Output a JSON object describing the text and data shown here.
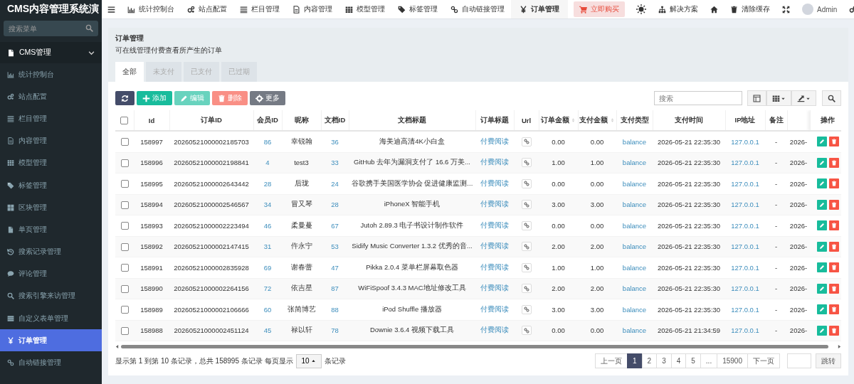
{
  "sidebar": {
    "title": "CMS内容管理系统演",
    "search": {
      "placeholder": "搜索菜单"
    },
    "group": {
      "label": "CMS管理",
      "expanded": true
    },
    "items": [
      {
        "label": "统计控制台",
        "selected": false
      },
      {
        "label": "站点配置",
        "selected": false
      },
      {
        "label": "栏目管理",
        "selected": false
      },
      {
        "label": "内容管理",
        "selected": false
      },
      {
        "label": "模型管理",
        "selected": false
      },
      {
        "label": "标签管理",
        "selected": false
      },
      {
        "label": "区块管理",
        "selected": false
      },
      {
        "label": "单页管理",
        "selected": false
      },
      {
        "label": "搜索记录管理",
        "selected": false
      },
      {
        "label": "评论管理",
        "selected": false
      },
      {
        "label": "搜索引擎来访管理",
        "selected": false
      },
      {
        "label": "自定义表单管理",
        "selected": false
      },
      {
        "label": "订单管理",
        "selected": true
      },
      {
        "label": "自动链接管理",
        "selected": false
      }
    ]
  },
  "topnav": {
    "tabs": [
      {
        "label": "统计控制台",
        "selected": false
      },
      {
        "label": "站点配置",
        "selected": false
      },
      {
        "label": "栏目管理",
        "selected": false
      },
      {
        "label": "内容管理",
        "selected": false
      },
      {
        "label": "模型管理",
        "selected": false
      },
      {
        "label": "标签管理",
        "selected": false
      },
      {
        "label": "自动链接管理",
        "selected": false
      },
      {
        "label": "订单管理",
        "selected": true
      }
    ],
    "buy_button": "立即购买",
    "solutions": "解决方案",
    "clear_cache": "清除缓存",
    "user": "Admin"
  },
  "panel": {
    "title": "订单管理",
    "subtitle": "可在线管理付费查看所产生的订单",
    "tabs": [
      {
        "label": "全部",
        "selected": true
      },
      {
        "label": "未支付",
        "selected": false
      },
      {
        "label": "已支付",
        "selected": false
      },
      {
        "label": "已过期",
        "selected": false
      }
    ]
  },
  "toolbar": {
    "buttons": [
      {
        "kind": "refresh",
        "disabled": false
      },
      {
        "kind": "add",
        "label": "添加",
        "disabled": false
      },
      {
        "kind": "edit",
        "label": "编辑",
        "disabled": true
      },
      {
        "kind": "delete",
        "label": "删除",
        "disabled": true
      },
      {
        "kind": "more",
        "label": "更多",
        "disabled": false
      }
    ],
    "search": {
      "placeholder": "搜索"
    }
  },
  "table": {
    "all_checked": false,
    "columns": [
      {
        "label": "Id",
        "sortable": false
      },
      {
        "label": "订单ID",
        "sortable": false
      },
      {
        "label": "会员ID",
        "sortable": false
      },
      {
        "label": "昵称",
        "sortable": false
      },
      {
        "label": "文档ID",
        "sortable": false
      },
      {
        "label": "文档标题",
        "sortable": false
      },
      {
        "label": "订单标题",
        "sortable": false
      },
      {
        "label": "Url",
        "sortable": false
      },
      {
        "label": "订单金额",
        "sortable": true
      },
      {
        "label": "支付金额",
        "sortable": true
      },
      {
        "label": "支付类型",
        "sortable": false
      },
      {
        "label": "支付时间",
        "sortable": false
      },
      {
        "label": "IP地址",
        "sortable": false
      },
      {
        "label": "备注",
        "sortable": false
      },
      {
        "sortable": false
      },
      {
        "label": "操作",
        "sortable": false
      }
    ],
    "rows": [
      {
        "checked": false,
        "id": "158997",
        "order_id": "20260521000002185703",
        "member_id": "86",
        "nickname": "幸锐翰",
        "doc_id": "36",
        "doc_title": "海美迪高清4K小白盒",
        "order_title": "付费阅读",
        "order_amount": "0.00",
        "pay_amount": "0.00",
        "pay_type": "balance",
        "pay_time": "2026-05-21 22:35:30",
        "ip": "127.0.0.1",
        "remark": "-",
        "column_15": "2026-"
      },
      {
        "checked": false,
        "id": "158996",
        "order_id": "20260521000002198841",
        "member_id": "4",
        "nickname": "test3",
        "doc_id": "33",
        "doc_title": "GitHub 去年为漏洞支付了 16.6 万美...",
        "order_title": "付费阅读",
        "order_amount": "1.00",
        "pay_amount": "1.00",
        "pay_type": "balance",
        "pay_time": "2026-05-21 22:35:30",
        "ip": "127.0.0.1",
        "remark": "-",
        "column_15": "2026-"
      },
      {
        "checked": false,
        "id": "158995",
        "order_id": "20260521000002643442",
        "member_id": "28",
        "nickname": "后珑",
        "doc_id": "24",
        "doc_title": "谷歌携手美国医学协会 促进健康监测...",
        "order_title": "付费阅读",
        "order_amount": "0.00",
        "pay_amount": "0.00",
        "pay_type": "balance",
        "pay_time": "2026-05-21 22:35:30",
        "ip": "127.0.0.1",
        "remark": "-",
        "column_15": "2026-"
      },
      {
        "checked": false,
        "id": "158994",
        "order_id": "20260521000002546567",
        "member_id": "34",
        "nickname": "冒又琴",
        "doc_id": "28",
        "doc_title": "iPhoneX 智能手机",
        "order_title": "付费阅读",
        "order_amount": "3.00",
        "pay_amount": "3.00",
        "pay_type": "balance",
        "pay_time": "2026-05-21 22:35:30",
        "ip": "127.0.0.1",
        "remark": "-",
        "column_15": "2026-"
      },
      {
        "checked": false,
        "id": "158993",
        "order_id": "20260521000002223494",
        "member_id": "46",
        "nickname": "柔曼蔓",
        "doc_id": "67",
        "doc_title": "Jutoh 2.89.3 电子书设计制作软件",
        "order_title": "付费阅读",
        "order_amount": "0.00",
        "pay_amount": "0.00",
        "pay_type": "balance",
        "pay_time": "2026-05-21 22:35:30",
        "ip": "127.0.0.1",
        "remark": "-",
        "column_15": "2026-"
      },
      {
        "checked": false,
        "id": "158992",
        "order_id": "20260521000002147415",
        "member_id": "31",
        "nickname": "仵永宁",
        "doc_id": "53",
        "doc_title": "Sidify Music Converter 1.3.2 优秀的音...",
        "order_title": "付费阅读",
        "order_amount": "2.00",
        "pay_amount": "2.00",
        "pay_type": "balance",
        "pay_time": "2026-05-21 22:35:30",
        "ip": "127.0.0.1",
        "remark": "-",
        "column_15": "2026-"
      },
      {
        "checked": false,
        "id": "158991",
        "order_id": "20260521000002835928",
        "member_id": "69",
        "nickname": "谢春蕾",
        "doc_id": "47",
        "doc_title": "Pikka 2.0.4 菜单栏屏幕取色器",
        "order_title": "付费阅读",
        "order_amount": "1.00",
        "pay_amount": "1.00",
        "pay_type": "balance",
        "pay_time": "2026-05-21 22:35:30",
        "ip": "127.0.0.1",
        "remark": "-",
        "column_15": "2026-"
      },
      {
        "checked": false,
        "id": "158990",
        "order_id": "20260521000002264156",
        "member_id": "72",
        "nickname": "依吉星",
        "doc_id": "87",
        "doc_title": "WiFiSpoof 3.4.3 MAC地址修改工具",
        "order_title": "付费阅读",
        "order_amount": "2.00",
        "pay_amount": "2.00",
        "pay_type": "balance",
        "pay_time": "2026-05-21 22:35:30",
        "ip": "127.0.0.1",
        "remark": "-",
        "column_15": "2026-"
      },
      {
        "checked": false,
        "id": "158989",
        "order_id": "20260521000002106666",
        "member_id": "60",
        "nickname": "张简博艺",
        "doc_id": "88",
        "doc_title": "iPod Shuffle 播放器",
        "order_title": "付费阅读",
        "order_amount": "3.00",
        "pay_amount": "3.00",
        "pay_type": "balance",
        "pay_time": "2026-05-21 22:35:30",
        "ip": "127.0.0.1",
        "remark": "-",
        "column_15": "2026-"
      },
      {
        "checked": false,
        "id": "158988",
        "order_id": "20260521000002451124",
        "member_id": "45",
        "nickname": "禄以轩",
        "doc_id": "78",
        "doc_title": "Downie 3.6.4 视频下载工具",
        "order_title": "付费阅读",
        "order_amount": "0.00",
        "pay_amount": "0.00",
        "pay_type": "balance",
        "pay_time": "2026-05-21 21:34:59",
        "ip": "127.0.0.1",
        "remark": "-",
        "column_15": "2026-"
      }
    ]
  },
  "footer": {
    "summary": "显示第 1 到第 10 条记录，总共 158995 条记录 每页显示",
    "page_size": "10",
    "suffix": "条记录"
  },
  "pagination": {
    "prev": "上一页",
    "pages": [
      {
        "label": "1",
        "selected": true
      },
      {
        "label": "2",
        "selected": false
      },
      {
        "label": "3",
        "selected": false
      },
      {
        "label": "4",
        "selected": false
      },
      {
        "label": "5",
        "selected": false
      },
      {
        "label": "...",
        "selected": false
      },
      {
        "label": "15900",
        "selected": false
      }
    ],
    "next": "下一页",
    "jump": "跳转"
  }
}
